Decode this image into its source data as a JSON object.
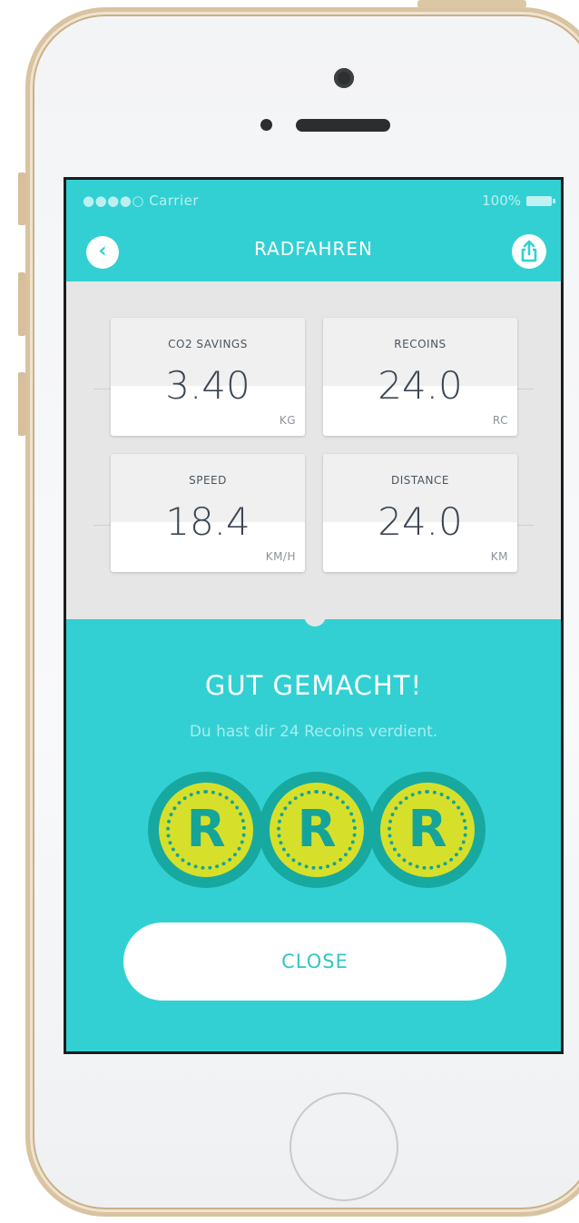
{
  "status_bar": {
    "carrier": "●●●●○ Carrier",
    "battery": "100%"
  },
  "navbar": {
    "title": "RADFAHREN",
    "back_icon": "chevron-left-icon",
    "share_icon": "share-icon"
  },
  "stats": [
    {
      "label": "CO2 SAVINGS",
      "value": "3.40",
      "unit": "KG"
    },
    {
      "label": "RECOINS",
      "value": "24.0",
      "unit": "RC"
    },
    {
      "label": "SPEED",
      "value": "18.4",
      "unit": "KM/H"
    },
    {
      "label": "DISTANCE",
      "value": "24.0",
      "unit": "KM"
    }
  ],
  "reward": {
    "headline": "GUT GEMACHT!",
    "subline": "Du hast dir 24 Recoins verdient.",
    "coin_symbol": "R",
    "coin_count": 3
  },
  "close_label": "CLOSE",
  "colors": {
    "accent": "#32d0d3",
    "coin_outer": "#17a99f",
    "coin_inner": "#d6e02a",
    "panel": "#e6e6e6"
  }
}
